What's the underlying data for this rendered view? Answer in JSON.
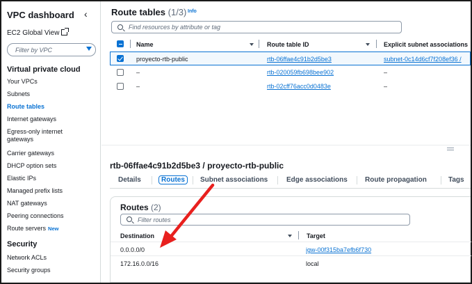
{
  "sidebar": {
    "title": "VPC dashboard",
    "ec2_global_view": "EC2 Global View",
    "filter_placeholder": "Filter by VPC",
    "section_vpc": "Virtual private cloud",
    "items": [
      {
        "label": "Your VPCs"
      },
      {
        "label": "Subnets"
      },
      {
        "label": "Route tables"
      },
      {
        "label": "Internet gateways"
      },
      {
        "label": "Egress-only internet gateways"
      },
      {
        "label": "Carrier gateways"
      },
      {
        "label": "DHCP option sets"
      },
      {
        "label": "Elastic IPs"
      },
      {
        "label": "Managed prefix lists"
      },
      {
        "label": "NAT gateways"
      },
      {
        "label": "Peering connections"
      },
      {
        "label": "Route servers",
        "badge": "New"
      }
    ],
    "section_security": "Security",
    "security_items": [
      {
        "label": "Network ACLs"
      },
      {
        "label": "Security groups"
      }
    ]
  },
  "route_tables": {
    "title": "Route tables",
    "count": "(1/3)",
    "info": "Info",
    "search_placeholder": "Find resources by attribute or tag",
    "columns": [
      "Name",
      "Route table ID",
      "Explicit subnet associations"
    ],
    "rows": [
      {
        "name": "proyecto-rtb-public",
        "id": "rtb-06ffae4c91b2d5be3",
        "subnets": "subnet-0c14d6cf7f208ef36 /",
        "selected": true
      },
      {
        "name": "–",
        "id": "rtb-020059fb698bee902",
        "subnets": "–",
        "selected": false
      },
      {
        "name": "–",
        "id": "rtb-02cff76acc0d0483e",
        "subnets": "–",
        "selected": false
      }
    ]
  },
  "detail": {
    "title": "rtb-06ffae4c91b2d5be3 / proyecto-rtb-public",
    "tabs": [
      "Details",
      "Routes",
      "Subnet associations",
      "Edge associations",
      "Route propagation",
      "Tags"
    ],
    "active_tab": "Routes"
  },
  "routes": {
    "title": "Routes",
    "count": "(2)",
    "search_placeholder": "Filter routes",
    "columns": [
      "Destination",
      "Target"
    ],
    "rows": [
      {
        "destination": "0.0.0.0/0",
        "target": "igw-00f315ba7efb6f730",
        "target_is_link": true
      },
      {
        "destination": "172.16.0.0/16",
        "target": "local",
        "target_is_link": false
      }
    ]
  },
  "colors": {
    "accent": "#0972d3",
    "annotation_arrow": "#e8201e"
  }
}
